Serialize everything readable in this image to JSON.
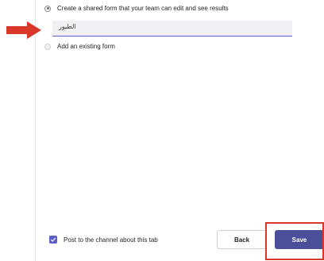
{
  "options": {
    "shared_form_label": "Create a shared form that your team can edit and see results",
    "shared_form_name_value": "الطيور",
    "existing_form_label": "Add an existing form"
  },
  "footer": {
    "post_to_channel_label": "Post to the channel about this tab",
    "post_to_channel_checked": true,
    "back_label": "Back",
    "save_label": "Save"
  },
  "annotations": {
    "arrow_color": "#d8372a",
    "highlight_color": "#d8372a"
  },
  "colors": {
    "accent": "#5b5fc7",
    "save_button": "#4b4f9a"
  }
}
